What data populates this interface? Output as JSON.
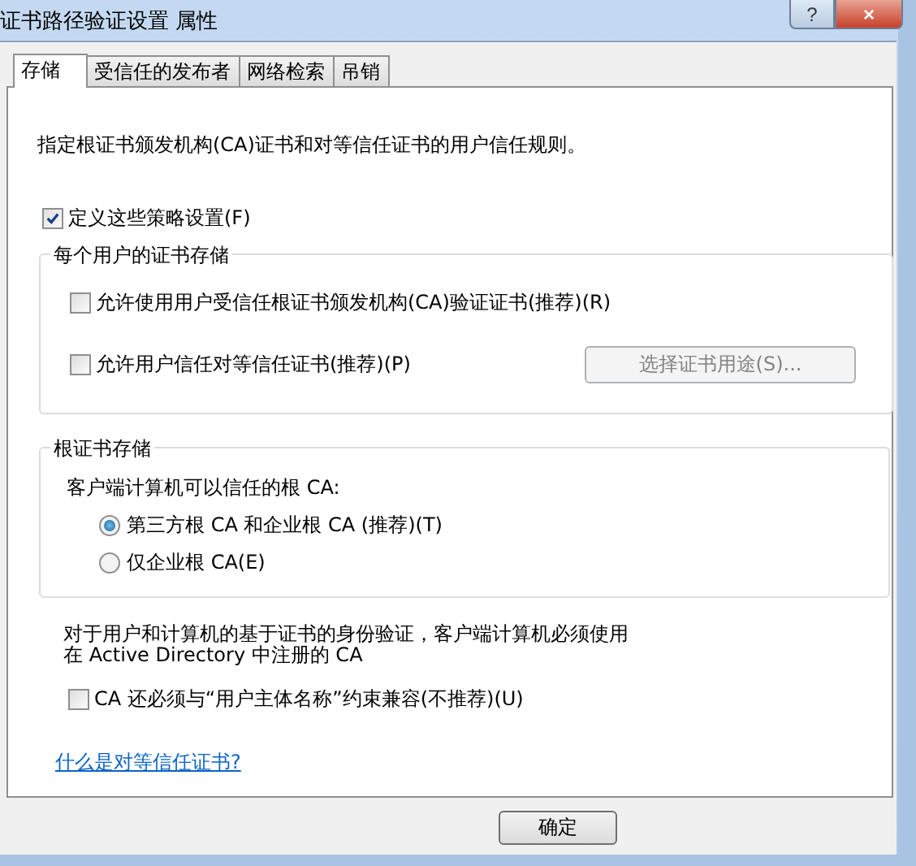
{
  "window": {
    "title": "证书路径验证设置 属性",
    "controls": [
      "?",
      "×"
    ]
  },
  "tabs": [
    {
      "label": "存储",
      "selected": true
    },
    {
      "label": "受信任的发布者",
      "selected": false
    },
    {
      "label": "网络检索",
      "selected": false
    },
    {
      "label": "吊销",
      "selected": false
    }
  ],
  "intro": "指定根证书颁发机构(CA)证书和对等信任证书的用户信任规则。",
  "define_policy": {
    "label": "定义这些策略设置(F)",
    "checked": true
  },
  "user_store": {
    "title": "每个用户的证书存储",
    "options": [
      {
        "label": "允许使用用户受信任根证书颁发机构(CA)验证证书(推荐)(R)",
        "checked": false
      },
      {
        "label": "允许用户信任对等信任证书(推荐)(P)",
        "checked": false
      }
    ],
    "button": {
      "label": "选择证书用途(S)...",
      "disabled": true
    }
  },
  "root_store": {
    "title": "根证书存储",
    "prompt": "客户端计算机可以信任的根 CA:",
    "options": [
      {
        "label": "第三方根 CA 和企业根 CA (推荐)(T)",
        "selected": true
      },
      {
        "label": "仅企业根 CA(E)",
        "selected": false
      }
    ]
  },
  "ad_note": "对于用户和计算机的基于证书的身份验证，客户端计算机必须使用在 Active Directory 中注册的 CA",
  "upn_option": {
    "label": "CA 还必须与“用户主体名称”约束兼容(不推荐)(U)",
    "checked": false
  },
  "help_link": "什么是对等信任证书?",
  "buttons": [
    {
      "label": "确定"
    }
  ]
}
